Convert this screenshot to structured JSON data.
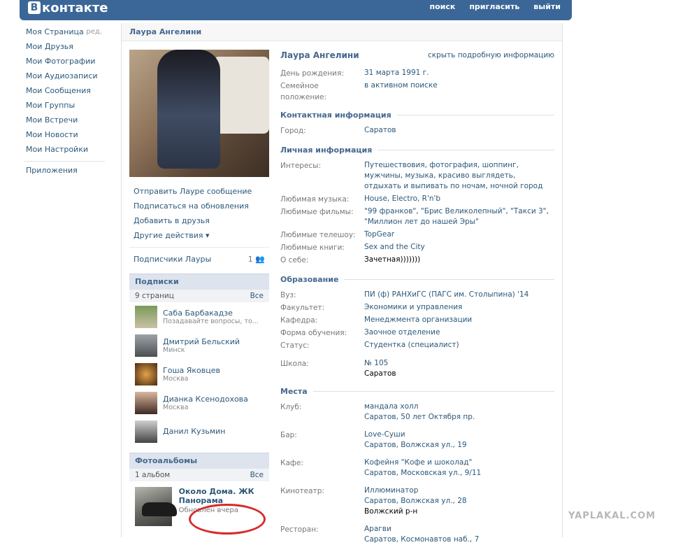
{
  "header": {
    "logo_letter": "В",
    "logo_text": "контакте",
    "nav": [
      "поиск",
      "пригласить",
      "выйти"
    ]
  },
  "leftmenu": {
    "items": [
      "Моя Страница",
      "Мои Друзья",
      "Мои Фотографии",
      "Мои Аудиозаписи",
      "Мои Сообщения",
      "Мои Группы",
      "Мои Встречи",
      "Мои Новости",
      "Мои Настройки"
    ],
    "edit_label": "ред.",
    "apps": "Приложения"
  },
  "profile": {
    "page_title": "Лаура Ангелини",
    "actions": [
      "Отправить Лауре сообщение",
      "Подписаться на обновления",
      "Добавить в друзья",
      "Другие действия ▾"
    ],
    "subscribers_label": "Подписчики Лауры",
    "subscribers_count": "1",
    "subscriptions": {
      "title": "Подписки",
      "count": "9 страниц",
      "all": "Все",
      "people": [
        {
          "name": "Саба Барбакадзе",
          "city": "Позадавайте вопросы, то..."
        },
        {
          "name": "Дмитрий Бельский",
          "city": "Минск"
        },
        {
          "name": "Гоша Яковцев",
          "city": "Москва"
        },
        {
          "name": "Дианка Ксенодохова",
          "city": "Москва"
        },
        {
          "name": "Данил Кузьмин",
          "city": ""
        }
      ]
    },
    "albums": {
      "title": "Фотоальбомы",
      "count": "1 альбом",
      "all": "Все",
      "album_title": "Около Дома. ЖК Панорама",
      "album_updated": "Обновлён вчера"
    }
  },
  "info": {
    "name": "Лаура Ангелини",
    "hide_link": "скрыть подробную информацию",
    "basic": [
      {
        "label": "День рождения:",
        "value": "31 марта 1991 г."
      },
      {
        "label": "Семейное положение:",
        "value": "в активном поиске"
      }
    ],
    "contact_title": "Контактная информация",
    "contact": [
      {
        "label": "Город:",
        "value": "Саратов"
      }
    ],
    "personal_title": "Личная информация",
    "personal": [
      {
        "label": "Интересы:",
        "value": "Путешествовия, фотография, шоппинг, мужчины, музыка, красиво выглядеть, отдыхать и выпивать по ночам, ночной город"
      },
      {
        "label": "Любимая музыка:",
        "value": "House, Electro, R'n'b"
      },
      {
        "label": "Любимые фильмы:",
        "value": "\"99 франков\", \"Брис Великолепный\", \"Такси 3\", \"Миллион лет до нашей Эры\""
      },
      {
        "label": "Любимые телешоу:",
        "value": "TopGear"
      },
      {
        "label": "Любимые книги:",
        "value": "Sex and the City"
      },
      {
        "label": "О себе:",
        "value": "Зачетная)))))))"
      }
    ],
    "edu_title": "Образование",
    "edu": [
      {
        "label": "Вуз:",
        "value": "ПИ (ф) РАНХиГС (ПАГС им. Столыпина) '14"
      },
      {
        "label": "Факультет:",
        "value": "Экономики и управления"
      },
      {
        "label": "Кафедра:",
        "value": "Менеджмента организации"
      },
      {
        "label": "Форма обучения:",
        "value": "Заочное отделение"
      },
      {
        "label": "Статус:",
        "value": "Студентка (специалист)"
      }
    ],
    "school_label": "Школа:",
    "school_value": "№ 105",
    "school_city": "Саратов",
    "places_title": "Места",
    "places": [
      {
        "label": "Клуб:",
        "l1": "мандала холл",
        "l2": "Саратов, 50 лет Октября пр."
      },
      {
        "label": "Бар:",
        "l1": "Love-Суши",
        "l2": "Саратов, Волжская ул., 19"
      },
      {
        "label": "Кафе:",
        "l1": "Кофейня \"Кофе и шоколад\"",
        "l2": "Саратов, Московская ул., 9/11"
      },
      {
        "label": "Кинотеатр:",
        "l1": "Иллюминатор",
        "l2": "Саратов, Волжская ул., 28",
        "l3": "Волжский р-н"
      },
      {
        "label": "Ресторан:",
        "l1": "Арагви",
        "l2": "Саратов, Космонавтов наб., 7"
      }
    ]
  },
  "watermark": "YAPLAKAL.COM"
}
